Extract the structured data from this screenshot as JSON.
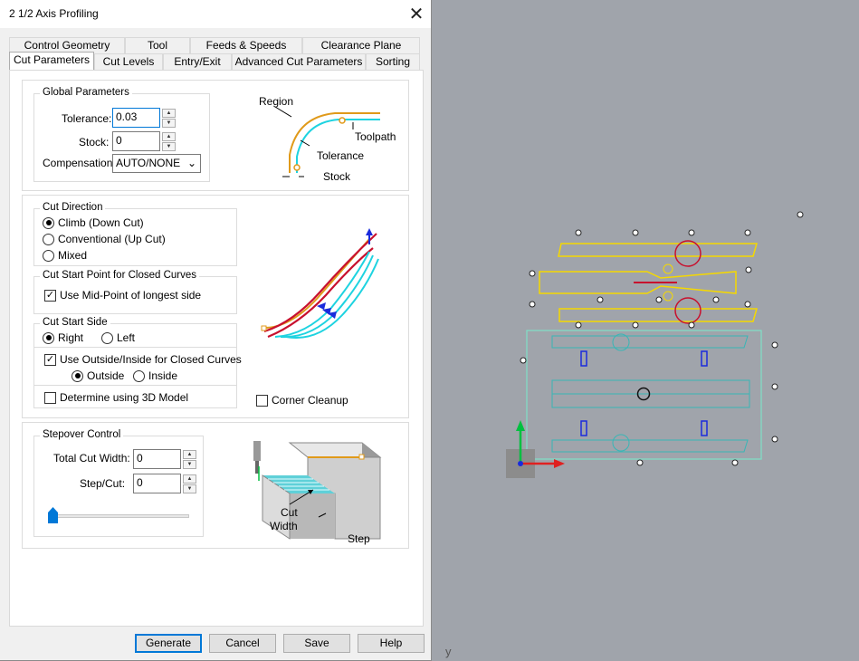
{
  "window": {
    "title": "2 1/2 Axis Profiling",
    "close_label": "✕"
  },
  "tabs": {
    "row1": [
      "Control Geometry",
      "Tool",
      "Feeds & Speeds",
      "Clearance Plane"
    ],
    "row2": [
      "Cut Parameters",
      "Cut Levels",
      "Entry/Exit",
      "Advanced Cut Parameters",
      "Sorting"
    ],
    "active": "Cut Parameters"
  },
  "global": {
    "legend": "Global Parameters",
    "tolerance_label": "Tolerance:",
    "tolerance_value": "0.03",
    "stock_label": "Stock:",
    "stock_value": "0",
    "compensation_label": "Compensation:",
    "compensation_value": "AUTO/NONE"
  },
  "region_diagram": {
    "region": "Region",
    "toolpath": "Toolpath",
    "tolerance": "Tolerance",
    "stock": "Stock"
  },
  "cut_direction": {
    "legend": "Cut Direction",
    "options": [
      "Climb (Down Cut)",
      "Conventional (Up Cut)",
      "Mixed"
    ],
    "selected": "Climb (Down Cut)"
  },
  "cut_start_point": {
    "legend": "Cut Start Point for Closed Curves",
    "midpoint_label": "Use Mid-Point of longest side",
    "midpoint_checked": true
  },
  "cut_start_side": {
    "legend": "Cut Start Side",
    "right_label": "Right",
    "left_label": "Left",
    "selected": "Right",
    "use_outside_inside_label": "Use Outside/Inside for Closed Curves",
    "use_outside_inside_checked": true,
    "outside_label": "Outside",
    "inside_label": "Inside",
    "side_selected": "Outside",
    "determine_3d_label": "Determine using 3D Model",
    "determine_3d_checked": false
  },
  "corner_cleanup": {
    "label": "Corner Cleanup",
    "checked": false
  },
  "stepover": {
    "legend": "Stepover Control",
    "total_cut_width_label": "Total Cut Width:",
    "total_cut_width_value": "0",
    "step_cut_label": "Step/Cut:",
    "step_cut_value": "0",
    "slider_value": 0
  },
  "stepover_diagram": {
    "cut": "Cut",
    "width": "Width",
    "step": "Step"
  },
  "buttons": {
    "generate": "Generate",
    "cancel": "Cancel",
    "save": "Save",
    "help": "Help"
  },
  "colors": {
    "dialog_bg": "#f0f0f0",
    "viewport_bg": "#a0a4ab",
    "toolpath_cyan": "#1ed3e0",
    "region_orange": "#e09a1a",
    "curve_yellow": "#f5d800",
    "curve_red": "#c8102e",
    "curve_blue": "#1a2bdc",
    "curve_teal": "#38b6b6"
  },
  "viewport": {
    "axis_label": "y"
  }
}
